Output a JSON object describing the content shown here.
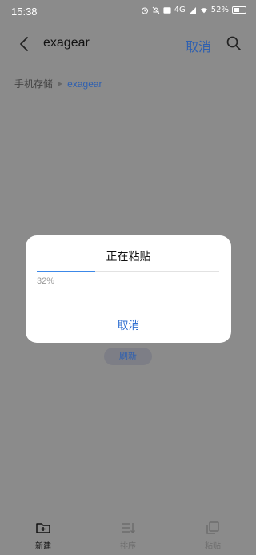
{
  "status": {
    "time": "15:38",
    "network": "4G",
    "wifi": "wifi",
    "battery": "52%"
  },
  "app_bar": {
    "title": "exagear",
    "cancel_label": "取消"
  },
  "breadcrumb": {
    "root": "手机存储",
    "current": "exagear"
  },
  "dialog": {
    "title": "正在粘贴",
    "progress_percent": 32,
    "progress_text": "32%",
    "cancel_label": "取消"
  },
  "refresh_label": "刷新",
  "bottom_bar": {
    "items": [
      {
        "label": "新建"
      },
      {
        "label": "排序"
      },
      {
        "label": "粘贴"
      }
    ]
  }
}
